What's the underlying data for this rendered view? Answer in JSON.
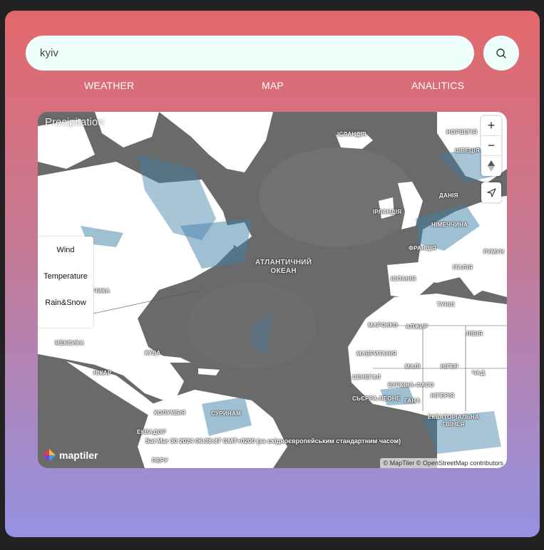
{
  "search": {
    "value": "kyiv",
    "placeholder": ""
  },
  "nav": {
    "weather": "WEATHER",
    "map": "MAP",
    "analytics": "ANALITICS"
  },
  "map": {
    "layer_title": "Precipitation",
    "layers": [
      "Wind",
      "Temperature",
      "Rain&Snow"
    ],
    "zoom_in": "+",
    "zoom_out": "−",
    "ocean_label": [
      "АТЛАНТИЧНИЙ",
      "ОКЕАН"
    ],
    "places": {
      "iceland": "ІСЛАНДІЯ",
      "norway": "НОРВЕГІЯ",
      "sweden": "ШВЕЦІЯ",
      "denmark": "ДАНІЯ",
      "ireland": "ІРЛАНДІЯ",
      "germany": "НІМЕЧЧИНА",
      "france": "ФРАНЦІЯ",
      "romania": "РУМУН",
      "italy": "ІТАЛІЯ",
      "spain": "ІСПАНІЯ",
      "tunisia": "ТУНІС",
      "morocco": "МАРОККО",
      "algeria": "АЛЖИР",
      "libya": "ЛІВІЯ",
      "mauritania": "МАВРИТАНІЯ",
      "mali": "МАЛІ",
      "niger": "НІГЕР",
      "chad": "ЧАД",
      "senegal": "СЕНЕГАЛ",
      "burkina": "БУРКІНА-ФАСО",
      "nigeria": "НІГЕРІЯ",
      "sierra": "СЬЄРРА-ЛЕОНЕ",
      "ghana": "ГАНА",
      "eq_guinea": "ЕКВАТОРІАЛЬНА ГВІНЕЯ",
      "cuba": "КУБА",
      "mexico": "МЕКСИКА",
      "colombia": "КОЛУМБІЯ",
      "suriname": "СУРИНАМ",
      "ecuador": "ЕКВАДОР",
      "peru": "ПЕРУ",
      "nicaragua": "НІКАР",
      "chicago": "ЧИКА"
    },
    "timestamp": "Sat Mar 30 2024 06:38:37 GMT+0200 (за східноєвропейським стандартним часом)",
    "logo": "maptiler",
    "attribution": "© MapTiler © OpenStreetMap contributors"
  },
  "colors": {
    "accent_top": "#e3686c",
    "accent_bottom": "#9592e2",
    "input_bg": "#effffb"
  }
}
